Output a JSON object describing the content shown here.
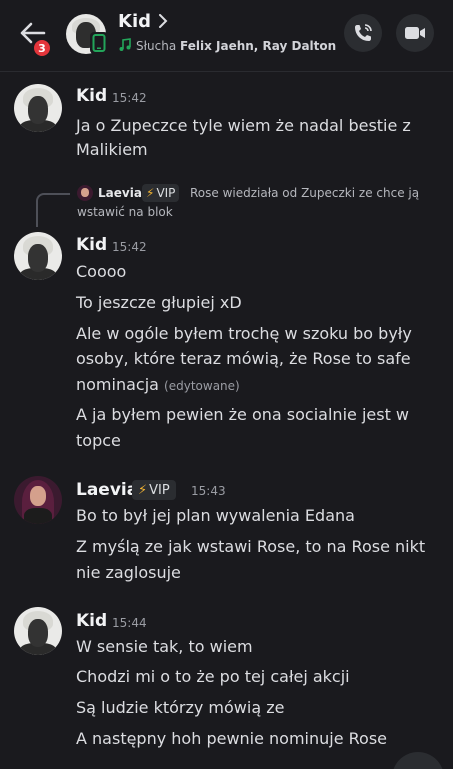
{
  "header": {
    "back_label": "",
    "unread_count": "3",
    "name": "Kid",
    "status_prefix": "Słucha ",
    "status_artists": "Felix Jaehn,  Ray Dalton",
    "icons": {
      "back": "arrow-left-icon",
      "chevron": "chevron-right-icon",
      "music": "music-note-icon",
      "phone_status": "mobile-phone-icon",
      "call": "phone-call-icon",
      "video": "video-camera-icon"
    }
  },
  "messages": [
    {
      "author": "Kid",
      "time": "15:42",
      "lines": [
        "Ja o Zupeczce tyle wiem że nadal bestie z",
        "Malikiem"
      ]
    },
    {
      "reply": {
        "author": "Laevia",
        "badge": "VIP",
        "text_lines": [
          "Rose wiedziała od Zupeczki ze chce ją",
          "wstawić na blok"
        ]
      },
      "author": "Kid",
      "time": "15:42",
      "lines": [
        "Coooo",
        "To jeszcze głupiej xD",
        "Ale w ogóle byłem trochę w szoku bo były",
        "osoby, które teraz mówią, że Rose to safe",
        "nominacja",
        "A ja byłem pewien że ona socialnie jest w",
        "topce"
      ],
      "edited_label": "(edytowane)"
    },
    {
      "author": "Laevia",
      "badge": "VIP",
      "time": "15:43",
      "lines": [
        "Bo to był jej plan wywalenia Edana",
        "Z myślą ze jak wstawi Rose, to na Rose nikt",
        "nie zaglosuje"
      ]
    },
    {
      "author": "Kid",
      "time": "15:44",
      "lines": [
        "W sensie tak, to wiem",
        "Chodzi mi o to że po tej całej akcji",
        "Są ludzie którzy mówią ze",
        "A następny hoh pewnie nominuje Rose"
      ]
    }
  ],
  "colors": {
    "background": "#1a1a1e",
    "badge_red": "#e3353b",
    "music_green": "#23a55a",
    "bolt_yellow": "#f0b232"
  }
}
